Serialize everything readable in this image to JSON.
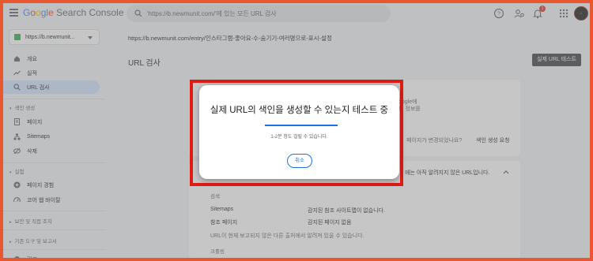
{
  "header": {
    "logo_google": [
      "G",
      "o",
      "o",
      "g",
      "l",
      "e"
    ],
    "logo_product": "Search Console",
    "search_text": "'https://b.newmunit.com/'에 있는 모든 URL 검사",
    "notification_count": "1",
    "avatar_text": "N"
  },
  "sidebar": {
    "property": "https://b.newmunit...",
    "items": [
      {
        "label": "개요",
        "icon": "home-icon"
      },
      {
        "label": "실적",
        "icon": "trending-icon"
      },
      {
        "label": "URL 검사",
        "icon": "search-icon",
        "active": true
      }
    ],
    "section_index": "색인 생성",
    "index_items": [
      {
        "label": "페이지",
        "icon": "pages-icon"
      },
      {
        "label": "Sitemaps",
        "icon": "sitemap-icon"
      },
      {
        "label": "삭제",
        "icon": "remove-icon"
      }
    ],
    "section_experience": "실험",
    "experience_items": [
      {
        "label": "페이지 경험",
        "icon": "add-circle-icon"
      },
      {
        "label": "코어 웹 바이탈",
        "icon": "speed-icon"
      }
    ],
    "section_security": "보안 및 직접 조치",
    "section_legacy": "기존 도구 및 보고서",
    "bottom_item": "링크"
  },
  "main": {
    "url_path": "https://b.newmunit.com/entry/인스타그램-좋아요-수-숨기기-여러명으로-표시-설정",
    "title": "URL 검사",
    "test_button": "실제 URL 테스트",
    "card1_ghost": "oogle에\n유 정보를",
    "card1_ask": "페이지가 변경되었나요?",
    "card1_request": "색인 생성 요청",
    "card2_header": "에는 아직 알려지지 않은 URL입니다.",
    "card2_section": "검색",
    "rows": [
      {
        "label": "Sitemaps",
        "value": "감지된 참조 사이트맵이 없습니다."
      },
      {
        "label": "참조 페이지",
        "value": "감지된 페이지 없음"
      }
    ],
    "note": "URL이 현재 보고되지 않은 다른 출처에서 알려져 있을 수 있습니다.",
    "crawl_section": "크롤링"
  },
  "dialog": {
    "title": "실제 URL의 색인을 생성할 수 있는지 테스트 중",
    "subtitle": "1-2분 정도 걸릴 수 있습니다.",
    "cancel_label": "취소",
    "progress": 1.0
  },
  "colors": {
    "frame_border": "#e8572f",
    "highlight_box": "#e01b14",
    "accent": "#1a73e8",
    "active_nav": "#d3e3fd"
  }
}
